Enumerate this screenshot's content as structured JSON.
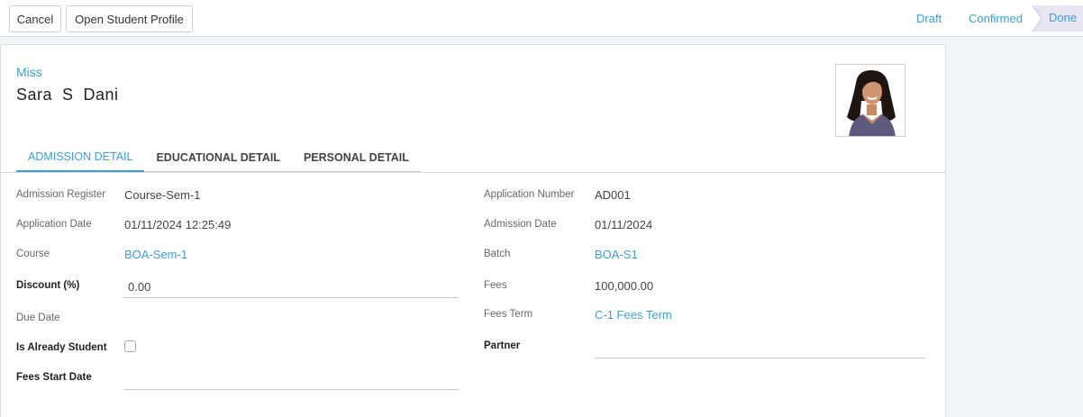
{
  "toolbar": {
    "cancel_label": "Cancel",
    "open_profile_label": "Open Student Profile"
  },
  "stages": {
    "draft": "Draft",
    "confirmed": "Confirmed",
    "done": "Done"
  },
  "header": {
    "title_prefix": "Miss",
    "student_name": "Sara  S  Dani",
    "avatar_icon": "student-photo"
  },
  "tabs": [
    {
      "label": "ADMISSION DETAIL"
    },
    {
      "label": "EDUCATIONAL DETAIL"
    },
    {
      "label": "PERSONAL DETAIL"
    }
  ],
  "left_fields": {
    "admission_register": {
      "label": "Admission Register",
      "value": "Course-Sem-1"
    },
    "application_date": {
      "label": "Application Date",
      "value": "01/11/2024 12:25:49"
    },
    "course": {
      "label": "Course",
      "value": "BOA-Sem-1"
    },
    "discount": {
      "label": "Discount (%)",
      "value": "0.00"
    },
    "due_date": {
      "label": "Due Date",
      "value": ""
    },
    "is_already_student": {
      "label": "Is Already Student",
      "checked": false
    },
    "fees_start_date": {
      "label": "Fees Start Date",
      "value": ""
    }
  },
  "right_fields": {
    "application_number": {
      "label": "Application Number",
      "value": "AD001"
    },
    "admission_date": {
      "label": "Admission Date",
      "value": "01/11/2024"
    },
    "batch": {
      "label": "Batch",
      "value": "BOA-S1"
    },
    "fees": {
      "label": "Fees",
      "value": "100,000.00"
    },
    "fees_term": {
      "label": "Fees Term",
      "value": "C-1 Fees Term"
    },
    "partner": {
      "label": "Partner",
      "value": ""
    }
  },
  "colors": {
    "accent": "#3a9ee0",
    "done_stage_bg": "#e8e6f3"
  }
}
